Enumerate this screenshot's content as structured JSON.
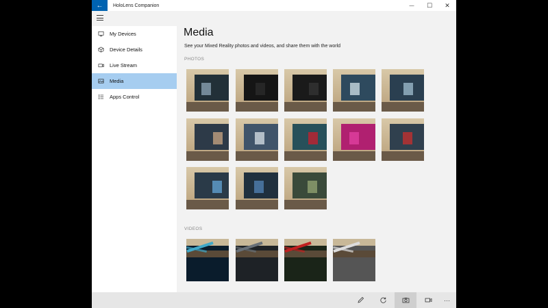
{
  "window": {
    "title": "HoloLens Companion",
    "back_glyph": "←",
    "minimize_glyph": "—",
    "maximize_glyph": "☐",
    "close_glyph": "✕"
  },
  "sidebar": {
    "items": [
      {
        "label": "My Devices",
        "icon": "display-icon",
        "active": false
      },
      {
        "label": "Device Details",
        "icon": "cube-icon",
        "active": false
      },
      {
        "label": "Live Stream",
        "icon": "video-camera-icon",
        "active": false
      },
      {
        "label": "Media",
        "icon": "image-icon",
        "active": true
      },
      {
        "label": "Apps Control",
        "icon": "list-icon",
        "active": false
      }
    ]
  },
  "main": {
    "title": "Media",
    "subtitle": "See your Mixed Reality photos and videos, and share them with the world",
    "photos_label": "PHOTOS",
    "videos_label": "VIDEOS"
  },
  "photos": [
    {
      "screen": "#223038",
      "accent": "#8aa0b0"
    },
    {
      "screen": "#151515",
      "accent": "#2a2a2a"
    },
    {
      "screen": "#1a1a1a",
      "accent": "#333333"
    },
    {
      "screen": "#2e4a5e",
      "accent": "#c8d8e0"
    },
    {
      "screen": "#2a3f50",
      "accent": "#9ab8c8"
    },
    {
      "screen": "#2d3a48",
      "accent": "#c0a080"
    },
    {
      "screen": "#40546a",
      "accent": "#d0d8e0"
    },
    {
      "screen": "#27505a",
      "accent": "#c02030"
    },
    {
      "screen": "#b02070",
      "accent": "#e040a0"
    },
    {
      "screen": "#30404e",
      "accent": "#c03030"
    },
    {
      "screen": "#2a3a48",
      "accent": "#60a0d0"
    },
    {
      "screen": "#20303e",
      "accent": "#5080b0"
    },
    {
      "screen": "#3a4a3a",
      "accent": "#90a070"
    }
  ],
  "videos": [
    {
      "bg": "#0a1c2c",
      "accent": "#40a8c8"
    },
    {
      "bg": "#1e2226",
      "accent": "#687078"
    },
    {
      "bg": "#1a2418",
      "accent": "#c02020"
    },
    {
      "bg": "#555555",
      "accent": "#dddddd"
    }
  ],
  "bottombar": {
    "buttons": [
      {
        "icon": "pencil-icon",
        "active": false
      },
      {
        "icon": "refresh-icon",
        "active": false
      },
      {
        "icon": "camera-icon",
        "active": true
      },
      {
        "icon": "video-icon",
        "active": false
      }
    ],
    "more_glyph": "···"
  }
}
